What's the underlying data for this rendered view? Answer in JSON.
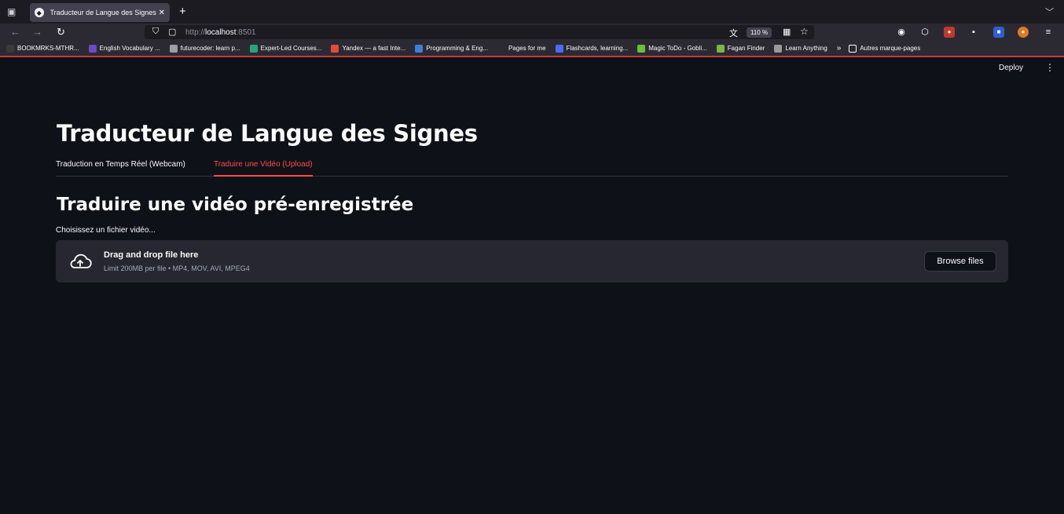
{
  "browser": {
    "tab_title": "Traducteur de Langue des Signes",
    "tab_close": "✕",
    "new_tab": "+",
    "url_prefix": "http://",
    "url_host": "localhost",
    "url_port": ":8501",
    "zoom": "110 %",
    "bookmarks": [
      {
        "label": "BOOKMRKS-MTHR...",
        "color": "#3a3a3a"
      },
      {
        "label": "English Vocabulary ...",
        "color": "#6b4cc2"
      },
      {
        "label": "futurecoder: learn p...",
        "color": "#9aa0a6"
      },
      {
        "label": "Expert-Led Courses...",
        "color": "#2aa37a"
      },
      {
        "label": "Yandex — a fast Inte...",
        "color": "#e24b3b"
      },
      {
        "label": "Programming & Eng...",
        "color": "#3f7fd8"
      },
      {
        "label": "Pages for me",
        "color": "#2b2a33"
      },
      {
        "label": "Flashcards, learning...",
        "color": "#4a6cf7"
      },
      {
        "label": "Magic ToDo - Gobli...",
        "color": "#6bbf3a"
      },
      {
        "label": "Fagan Finder",
        "color": "#7ab648"
      },
      {
        "label": "Learn Anything",
        "color": "#9a9a9a"
      }
    ],
    "bookmarks_more": "»",
    "other_bookmarks": "Autres marque-pages"
  },
  "app": {
    "deploy": "Deploy",
    "menu": "⋮",
    "title": "Traducteur de Langue des Signes",
    "tabs": [
      {
        "label": "Traduction en Temps Réel (Webcam)"
      },
      {
        "label": "Traduire une Vidéo (Upload)"
      }
    ],
    "subheader": "Traduire une vidéo pré-enregistrée",
    "uploader": {
      "label": "Choisissez un fichier vidéo...",
      "drag_text": "Drag and drop file here",
      "limit_text": "Limit 200MB per file • MP4, MOV, AVI, MPEG4",
      "browse_label": "Browse files"
    }
  },
  "colors": {
    "accent": "#ff4b4b",
    "background": "#0e1117",
    "dropzone": "#262730"
  }
}
